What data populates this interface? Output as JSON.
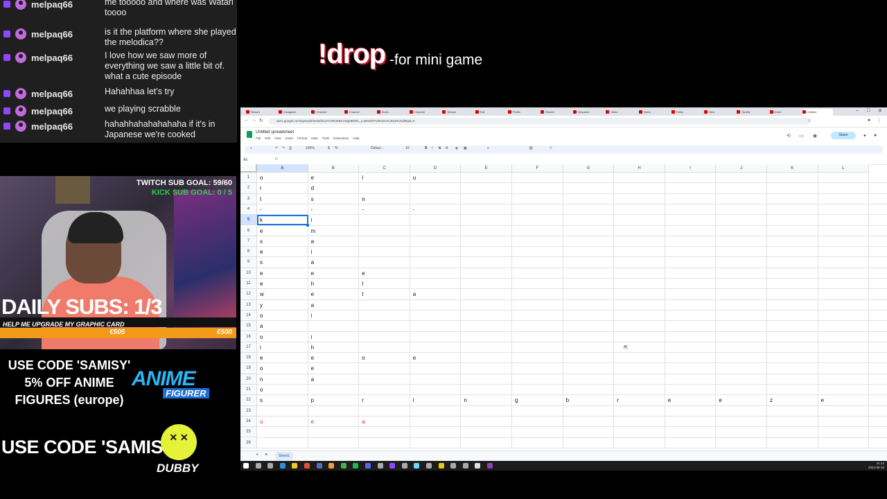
{
  "chat": {
    "messages": [
      {
        "user": "melpaq66",
        "text": "me tooooo and where was Watari toooo"
      },
      {
        "user": "melpaq66",
        "text": "is it the platform where she played the melodica??"
      },
      {
        "user": "melpaq66",
        "text": "I love how we saw more of everything we saw a little bit of. what a cute episode"
      },
      {
        "user": "melpaq66",
        "text": "Hahahhaa let's try"
      },
      {
        "user": "melpaq66",
        "text": "we playing scrabble"
      },
      {
        "user": "melpaq66",
        "text": "hahahhahahahahaha if it's in Japanese we're cooked"
      }
    ]
  },
  "overlay": {
    "twitch_goal": "TWITCH SUB GOAL: 59/60",
    "kick_goal": "KICK SUB GOAL: 0 / 5",
    "daily_subs": "DAILY SUBS: 1/3",
    "graphics_card": "HELP ME UPGRADE MY GRAPHIC CARD",
    "progress_current": "€505",
    "progress_target": "€500",
    "progress_fraction": 1.0,
    "code_text_1": "USE CODE 'SAMISY' 5% OFF ANIME FIGURES (europe)",
    "anime_logo_top": "ANIME",
    "anime_logo_bottom": "FIGURER",
    "code_text_2": "USE CODE 'SAMISY'",
    "dubby_face": "✕ ✕",
    "dubby_label": "DUBBY",
    "drop_command": "!drop",
    "drop_description": "-for mini game"
  },
  "browser": {
    "tabs": [
      "Stream",
      "Instagram",
      "Channel",
      "Channel",
      "Video",
      "Channel",
      "Stream",
      "Edit",
      "Profile",
      "Stream",
      "Mixpanel",
      "Video",
      "Video",
      "Editor",
      "New",
      "Spotify",
      "Excel",
      "Untitled"
    ],
    "url": "docs.google.com/spreadsheets/d/1LFC9hOEBo7sdg0BSRL_LusK8vf4Tv0K4evXU3saHc/edit#gid=0",
    "doc_title": "Untitled spreadsheet",
    "menu": [
      "File",
      "Edit",
      "View",
      "Insert",
      "Format",
      "Data",
      "Tools",
      "Extensions",
      "Help"
    ],
    "share_label": "Share",
    "zoom": "100%",
    "font_label": "Defaul...",
    "font_size": "10",
    "cell_ref": "A5",
    "sheet_tab": "Sheet1"
  },
  "sheet": {
    "columns": [
      "A",
      "B",
      "C",
      "D",
      "E",
      "F",
      "G",
      "H",
      "I",
      "J",
      "K",
      "L"
    ],
    "rows": [
      "1",
      "2",
      "3",
      "4",
      "5",
      "6",
      "7",
      "8",
      "9",
      "10",
      "11",
      "12",
      "13",
      "14",
      "15",
      "16",
      "17",
      "18",
      "19",
      "20",
      "21",
      "22",
      "23",
      "24",
      "25",
      "26"
    ],
    "selected_column": "A",
    "selected_row": "5",
    "cells": [
      {
        "r": 0,
        "c": 0,
        "v": "o"
      },
      {
        "r": 0,
        "c": 1,
        "v": "e"
      },
      {
        "r": 0,
        "c": 2,
        "v": "l"
      },
      {
        "r": 0,
        "c": 3,
        "v": "u"
      },
      {
        "r": 1,
        "c": 0,
        "v": "r"
      },
      {
        "r": 1,
        "c": 1,
        "v": "d"
      },
      {
        "r": 2,
        "c": 0,
        "v": "t"
      },
      {
        "r": 2,
        "c": 1,
        "v": "s"
      },
      {
        "r": 2,
        "c": 2,
        "v": "n"
      },
      {
        "r": 3,
        "c": 0,
        "v": "-"
      },
      {
        "r": 3,
        "c": 1,
        "v": "-"
      },
      {
        "r": 3,
        "c": 2,
        "v": "-"
      },
      {
        "r": 3,
        "c": 3,
        "v": "-"
      },
      {
        "r": 4,
        "c": 0,
        "v": "k"
      },
      {
        "r": 4,
        "c": 1,
        "v": "i"
      },
      {
        "r": 5,
        "c": 0,
        "v": "e"
      },
      {
        "r": 5,
        "c": 1,
        "v": "m"
      },
      {
        "r": 6,
        "c": 0,
        "v": "s"
      },
      {
        "r": 6,
        "c": 1,
        "v": "a"
      },
      {
        "r": 7,
        "c": 0,
        "v": "e"
      },
      {
        "r": 7,
        "c": 1,
        "v": "i"
      },
      {
        "r": 8,
        "c": 0,
        "v": "s"
      },
      {
        "r": 8,
        "c": 1,
        "v": "a"
      },
      {
        "r": 9,
        "c": 0,
        "v": "e"
      },
      {
        "r": 9,
        "c": 1,
        "v": "e"
      },
      {
        "r": 9,
        "c": 2,
        "v": "e"
      },
      {
        "r": 10,
        "c": 0,
        "v": "e"
      },
      {
        "r": 10,
        "c": 1,
        "v": "h"
      },
      {
        "r": 10,
        "c": 2,
        "v": "t"
      },
      {
        "r": 11,
        "c": 0,
        "v": "w"
      },
      {
        "r": 11,
        "c": 1,
        "v": "e"
      },
      {
        "r": 11,
        "c": 2,
        "v": "t"
      },
      {
        "r": 11,
        "c": 3,
        "v": "a"
      },
      {
        "r": 12,
        "c": 0,
        "v": "y"
      },
      {
        "r": 12,
        "c": 1,
        "v": "a"
      },
      {
        "r": 13,
        "c": 0,
        "v": "o"
      },
      {
        "r": 13,
        "c": 1,
        "v": "i"
      },
      {
        "r": 14,
        "c": 0,
        "v": "a"
      },
      {
        "r": 15,
        "c": 0,
        "v": "o"
      },
      {
        "r": 15,
        "c": 1,
        "v": "i"
      },
      {
        "r": 16,
        "c": 0,
        "v": "i"
      },
      {
        "r": 16,
        "c": 1,
        "v": "h"
      },
      {
        "r": 17,
        "c": 0,
        "v": "e"
      },
      {
        "r": 17,
        "c": 1,
        "v": "e"
      },
      {
        "r": 17,
        "c": 2,
        "v": "o"
      },
      {
        "r": 17,
        "c": 3,
        "v": "e"
      },
      {
        "r": 18,
        "c": 0,
        "v": "o"
      },
      {
        "r": 18,
        "c": 1,
        "v": "e"
      },
      {
        "r": 19,
        "c": 0,
        "v": "n"
      },
      {
        "r": 19,
        "c": 1,
        "v": "a"
      },
      {
        "r": 20,
        "c": 0,
        "v": "o"
      },
      {
        "r": 21,
        "c": 0,
        "v": "s"
      },
      {
        "r": 21,
        "c": 1,
        "v": "p"
      },
      {
        "r": 21,
        "c": 2,
        "v": "r"
      },
      {
        "r": 21,
        "c": 3,
        "v": "i"
      },
      {
        "r": 21,
        "c": 4,
        "v": "n"
      },
      {
        "r": 21,
        "c": 5,
        "v": "g"
      },
      {
        "r": 21,
        "c": 6,
        "v": "b"
      },
      {
        "r": 21,
        "c": 7,
        "v": "r"
      },
      {
        "r": 21,
        "c": 8,
        "v": "e"
      },
      {
        "r": 21,
        "c": 9,
        "v": "e"
      },
      {
        "r": 21,
        "c": 10,
        "v": "z"
      },
      {
        "r": 21,
        "c": 11,
        "v": "e"
      },
      {
        "r": 23,
        "c": 0,
        "v": "u",
        "red": true
      },
      {
        "r": 23,
        "c": 1,
        "v": "e",
        "red": true
      },
      {
        "r": 23,
        "c": 2,
        "v": "a",
        "red": true
      }
    ]
  },
  "taskbar": {
    "time": "21:14",
    "date": "2024-06-10"
  },
  "colors": {
    "accent": "#1a73e8",
    "twitch": "#9146ff",
    "kick": "#2ad04a",
    "progress": "#f29a1a",
    "drop_shadow": "#c0182a",
    "red_cell": "#d93025"
  }
}
